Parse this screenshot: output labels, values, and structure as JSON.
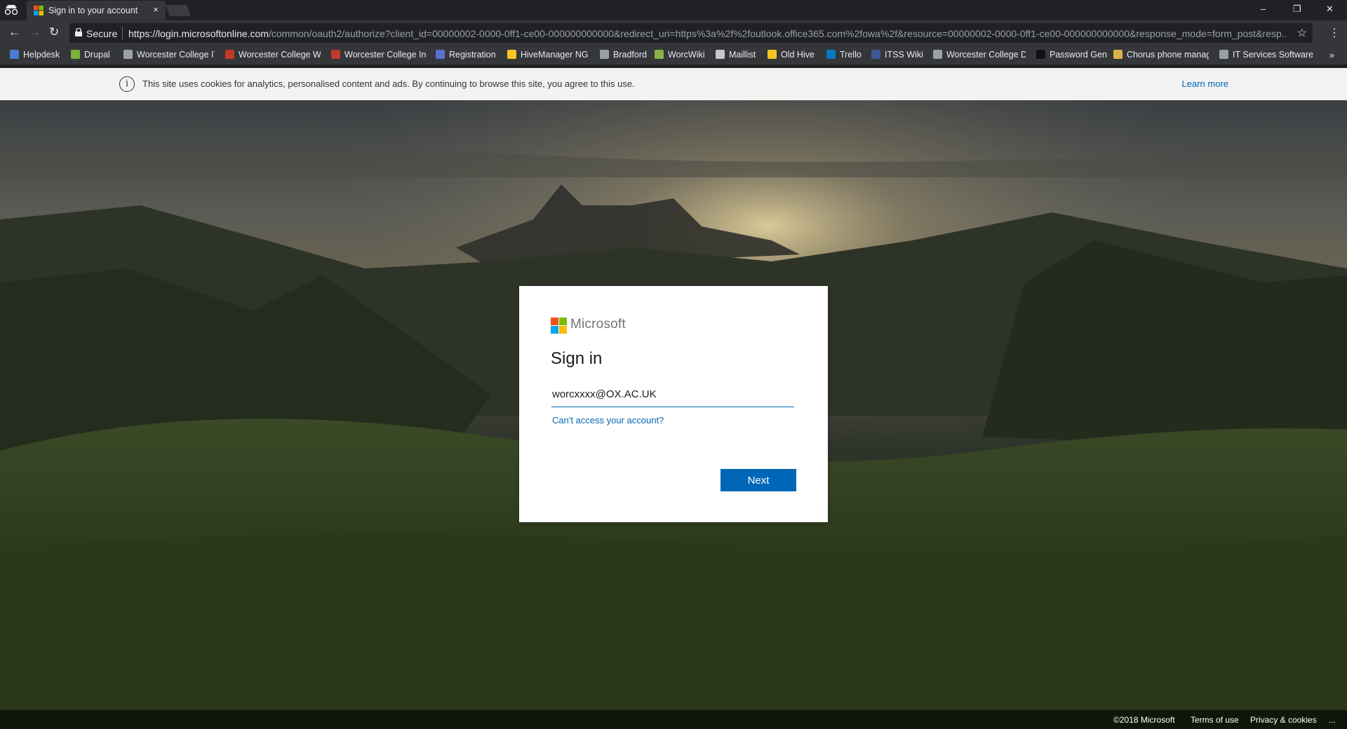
{
  "tab": {
    "title": "Sign in to your account",
    "close": "×"
  },
  "window": {
    "minimize": "–",
    "restore": "❐",
    "close": "✕"
  },
  "nav": {
    "back": "←",
    "forward": "→",
    "reload": "↻"
  },
  "address": {
    "secure_label": "Secure",
    "url_host": "https://login.microsoftonline.com",
    "url_rest": "/common/oauth2/authorize?client_id=00000002-0000-0ff1-ce00-000000000000&redirect_uri=https%3a%2f%2foutlook.office365.com%2fowa%2f&resource=00000002-0000-0ff1-ce00-000000000000&response_mode=form_post&resp...",
    "star": "☆",
    "menu": "⋮"
  },
  "bookmarks": [
    {
      "label": "Helpdesk",
      "color": "#4a7bd0"
    },
    {
      "label": "Drupal",
      "color": "#7bb23b"
    },
    {
      "label": "Worcester College IT",
      "color": "#9aa0a6"
    },
    {
      "label": "Worcester College W",
      "color": "#c0392b"
    },
    {
      "label": "Worcester College In",
      "color": "#c0392b"
    },
    {
      "label": "Registration",
      "color": "#5b6fd1"
    },
    {
      "label": "HiveManager NG",
      "color": "#f3c623"
    },
    {
      "label": "Bradford",
      "color": "#9aa0a6"
    },
    {
      "label": "WorcWiki",
      "color": "#8ab04a"
    },
    {
      "label": "Maillist",
      "color": "#c7c7c7"
    },
    {
      "label": "Old Hive",
      "color": "#f3c623"
    },
    {
      "label": "Trello",
      "color": "#0079bf"
    },
    {
      "label": "ITSS Wiki",
      "color": "#3b5998"
    },
    {
      "label": "Worcester College Da",
      "color": "#9aa0a6"
    },
    {
      "label": "Password Gen",
      "color": "#111111"
    },
    {
      "label": "Chorus phone manag",
      "color": "#d9b44a"
    },
    {
      "label": "IT Services Software I",
      "color": "#9aa0a6"
    }
  ],
  "bookmarks_more": "»",
  "cookie_banner": {
    "icon": "i",
    "text": "This site uses cookies for analytics, personalised content and ads. By continuing to browse this site, you agree to this use.",
    "link": "Learn more"
  },
  "signin": {
    "brand": "Microsoft",
    "heading": "Sign in",
    "email_value": "worcxxxx@OX.AC.UK",
    "cant_access": "Can't access your account?",
    "next": "Next",
    "logo_colors": [
      "#f25022",
      "#7fba00",
      "#00a4ef",
      "#ffb900"
    ]
  },
  "footer": {
    "copyright": "©2018 Microsoft",
    "terms": "Terms of use",
    "privacy": "Privacy & cookies",
    "more": "..."
  }
}
